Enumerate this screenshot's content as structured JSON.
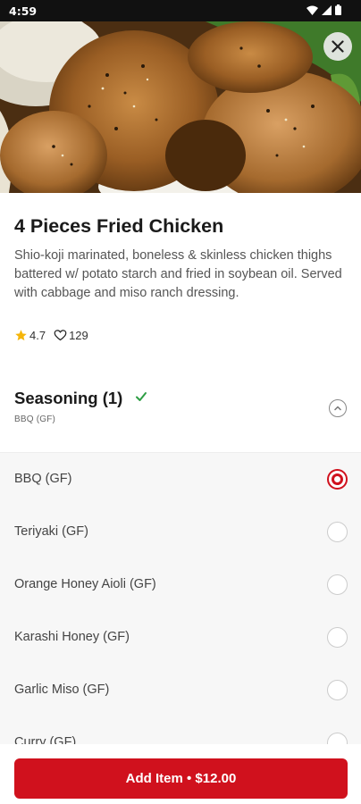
{
  "status_bar": {
    "time": "4:59"
  },
  "item": {
    "title": "4 Pieces Fried Chicken",
    "description": "Shio-koji marinated, boneless & skinless chicken thighs battered w/ potato starch and fried in soybean oil. Served with cabbage and miso ranch dressing.",
    "rating": "4.7",
    "likes": "129"
  },
  "section": {
    "title": "Seasoning (1)",
    "subtitle": "BBQ (GF)",
    "options": [
      {
        "label": "BBQ (GF)",
        "selected": true
      },
      {
        "label": "Teriyaki (GF)",
        "selected": false
      },
      {
        "label": "Orange Honey Aioli (GF)",
        "selected": false
      },
      {
        "label": "Karashi Honey (GF)",
        "selected": false
      },
      {
        "label": "Garlic Miso (GF)",
        "selected": false
      },
      {
        "label": "Curry (GF)",
        "selected": false
      }
    ]
  },
  "footer": {
    "add_button": "Add Item • $12.00"
  },
  "colors": {
    "accent": "#d0111d",
    "check": "#2e9e44",
    "star": "#f5b50a"
  },
  "icons": [
    "wifi-icon",
    "signal-icon",
    "battery-icon",
    "close-icon",
    "star-icon",
    "heart-icon",
    "checkmark-icon",
    "chevron-up-icon"
  ]
}
